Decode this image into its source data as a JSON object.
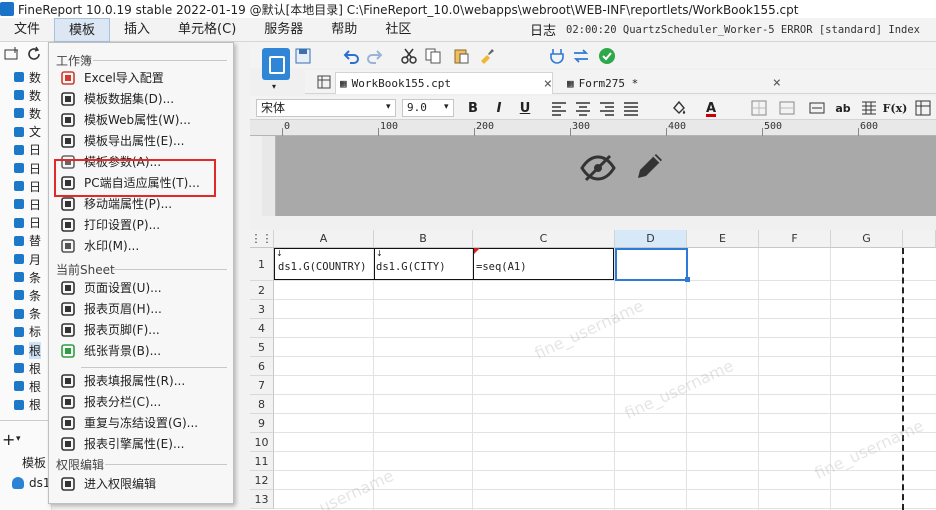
{
  "window": {
    "title": "FineReport 10.0.19 stable 2022-01-19 @默认[本地目录]    C:\\FineReport_10.0\\webapps\\webroot\\WEB-INF\\reportlets/WorkBook155.cpt"
  },
  "menubar": {
    "items": [
      "文件",
      "模板",
      "插入",
      "单元格(C)",
      "服务器",
      "帮助",
      "社区"
    ],
    "active_index": 1,
    "log_label": "日志",
    "status_text": "02:00:20 QuartzScheduler_Worker-5 ERROR [standard] Index"
  },
  "left_tree": {
    "items": [
      "数",
      "数",
      "数",
      "文",
      "日",
      "日",
      "日",
      "日",
      "日",
      "替",
      "月",
      "条",
      "条",
      "条",
      "标",
      "根",
      "根",
      "根",
      "根"
    ],
    "selected_index": 15,
    "bottom_label": "模板",
    "dataset_label": "ds1"
  },
  "dropdown": {
    "section_workbook": "工作簿",
    "section_sheet": "当前Sheet",
    "section_permission": "权限编辑",
    "items_workbook": [
      {
        "label": "Excel导入配置",
        "icon": "excel-import-icon",
        "color": "#d23b2f"
      },
      {
        "label": "模板数据集(D)...",
        "icon": "database-icon",
        "color": "#333333"
      },
      {
        "label": "模板Web属性(W)...",
        "icon": "globe-icon",
        "color": "#333333"
      },
      {
        "label": "模板导出属性(E)...",
        "icon": "export-icon",
        "color": "#333333"
      },
      {
        "label": "模板参数(A)...",
        "icon": "parameter-icon",
        "color": "#666666"
      },
      {
        "label": "PC端自适应属性(T)...",
        "icon": "resize-icon",
        "color": "#333333"
      },
      {
        "label": "移动端属性(P)...",
        "icon": "mobile-icon",
        "color": "#333333"
      },
      {
        "label": "打印设置(P)...",
        "icon": "printer-icon",
        "color": "#333333"
      },
      {
        "label": "水印(M)...",
        "icon": "watermark-icon",
        "color": "#555555"
      }
    ],
    "items_sheet": [
      {
        "label": "页面设置(U)...",
        "icon": "page-setup-icon",
        "color": "#333333"
      },
      {
        "label": "报表页眉(H)...",
        "icon": "header-icon",
        "color": "#333333"
      },
      {
        "label": "报表页脚(F)...",
        "icon": "footer-icon",
        "color": "#333333"
      },
      {
        "label": "纸张背景(B)...",
        "icon": "background-image-icon",
        "color": "#2f9e44"
      },
      {
        "label": "报表填报属性(R)...",
        "icon": "fill-report-icon",
        "color": "#333333"
      },
      {
        "label": "报表分栏(C)...",
        "icon": "columns-icon",
        "color": "#333333"
      },
      {
        "label": "重复与冻结设置(G)...",
        "icon": "freeze-icon",
        "color": "#333333"
      },
      {
        "label": "报表引擎属性(E)...",
        "icon": "engine-icon",
        "color": "#333333"
      }
    ],
    "items_permission": [
      {
        "label": "进入权限编辑",
        "icon": "permission-icon",
        "color": "#333333"
      }
    ]
  },
  "tabs": [
    {
      "label": "WorkBook155.cpt",
      "active": true
    },
    {
      "label": "Form275 *",
      "active": false
    }
  ],
  "format_toolbar": {
    "font": "宋体",
    "size": "9.0",
    "bold": "B",
    "italic": "I",
    "underline": "U"
  },
  "ruler": {
    "labels": [
      "0",
      "100",
      "200",
      "300",
      "400",
      "500",
      "600"
    ]
  },
  "sheet": {
    "columns": [
      "A",
      "B",
      "C",
      "D",
      "E",
      "F",
      "G"
    ],
    "selected_column": "D",
    "rows": [
      "1",
      "2",
      "3",
      "4",
      "5",
      "6",
      "7",
      "8",
      "9",
      "10",
      "11",
      "12",
      "13"
    ],
    "cells": {
      "A1": "ds1.G(COUNTRY)",
      "B1": "ds1.G(CITY)",
      "C1": "=seq(A1)"
    },
    "watermark": "fine_username"
  },
  "colors": {
    "accent": "#2d7bd6",
    "highlight": "#e02a2a",
    "menu_active": "#dde7f3"
  }
}
